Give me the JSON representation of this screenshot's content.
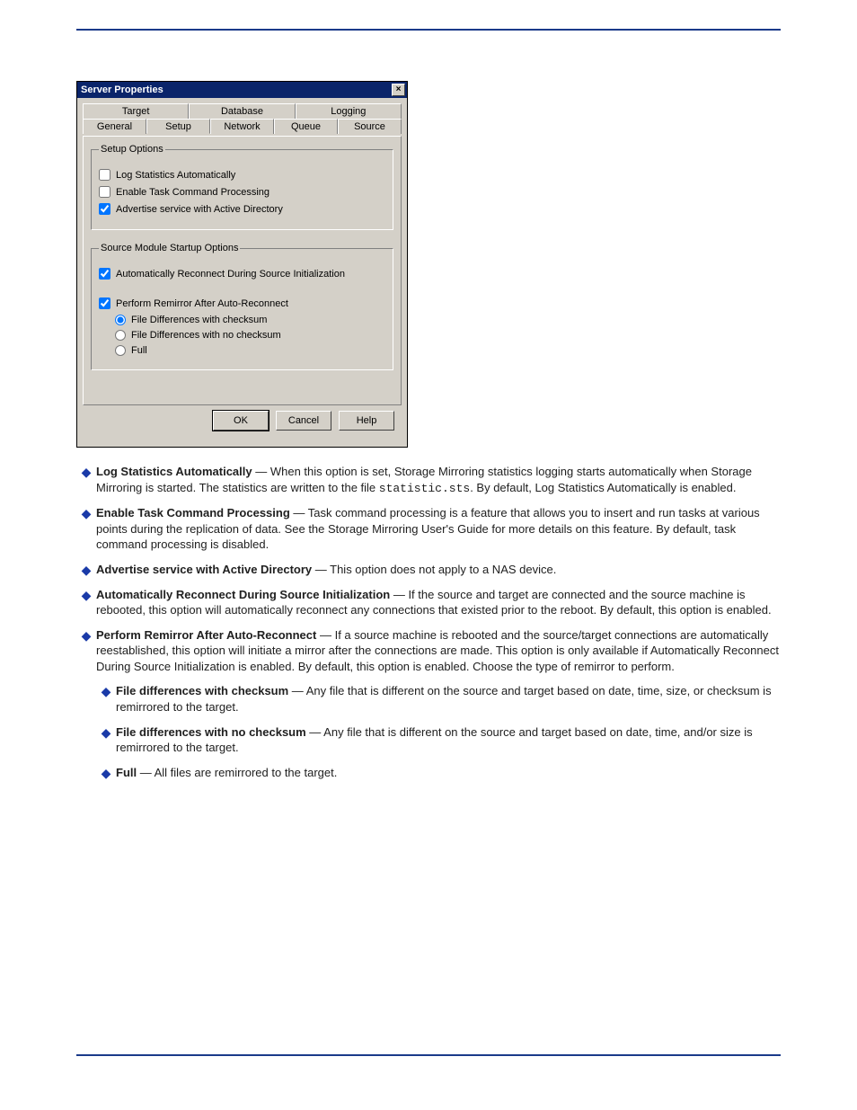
{
  "dialog": {
    "title": "Server Properties",
    "close_glyph": "×",
    "tabs_back": [
      "Target",
      "Database",
      "Logging"
    ],
    "tabs_front": [
      "General",
      "Setup",
      "Network",
      "Queue",
      "Source"
    ],
    "active_tab_index": 1,
    "group1": {
      "legend": "Setup Options",
      "chk1": {
        "label": "Log Statistics Automatically",
        "checked": false
      },
      "chk2": {
        "label": "Enable Task Command Processing",
        "checked": false
      },
      "chk3": {
        "label": "Advertise service with Active Directory",
        "checked": true
      }
    },
    "group2": {
      "legend": "Source Module Startup Options",
      "chk_reconnect": {
        "label": "Automatically Reconnect During Source Initialization",
        "checked": true
      },
      "chk_remirror": {
        "label": "Perform Remirror After Auto-Reconnect",
        "checked": true
      },
      "radios": {
        "r1": "File Differences with checksum",
        "r2": "File Differences with no checksum",
        "r3": "Full",
        "selected": "r1"
      }
    },
    "buttons": {
      "ok": "OK",
      "cancel": "Cancel",
      "help": "Help"
    }
  },
  "bullets": {
    "b1": {
      "lead": "Log Statistics Automatically",
      "rest": " — When this option is set, Storage Mirroring statistics logging starts automatically when Storage Mirroring is started. The statistics are written to the file ",
      "code": "statistic.sts",
      "rest2": ". By default, Log Statistics Automatically is enabled."
    },
    "b2": {
      "lead": "Enable Task Command Processing",
      "rest": " — Task command processing is a feature that allows you to insert and run tasks at various points during the replication of data. See the Storage Mirroring User's Guide for more details on this feature. By default, task command processing is disabled."
    },
    "b3": {
      "lead": "Advertise service with Active Directory",
      "rest": " — This option does not apply to a NAS device."
    },
    "b4": {
      "lead": "Automatically Reconnect During Source Initialization",
      "rest": " — If the source and target are connected and the source machine is rebooted, this option will automatically reconnect any connections that existed prior to the reboot. By default, this option is enabled."
    },
    "b5": {
      "lead": "Perform Remirror After Auto-Reconnect",
      "rest": " — If a source machine is rebooted and the source/target connections are automatically reestablished, this option will initiate a mirror after the connections are made. This option is only available if Automatically Reconnect During Source Initialization is enabled. By default, this option is enabled. Choose the type of remirror to perform."
    },
    "sub": {
      "s1": {
        "lead": "File differences with checksum",
        "rest": " — Any file that is different on the source and target based on date, time, size, or checksum is remirrored to the target."
      },
      "s2": {
        "lead": "File differences with no checksum",
        "rest": " — Any file that is different on the source and target based on date, time, and/or size is remirrored to the target."
      },
      "s3": {
        "lead": "Full",
        "rest": " — All files are remirrored to the target."
      }
    }
  }
}
